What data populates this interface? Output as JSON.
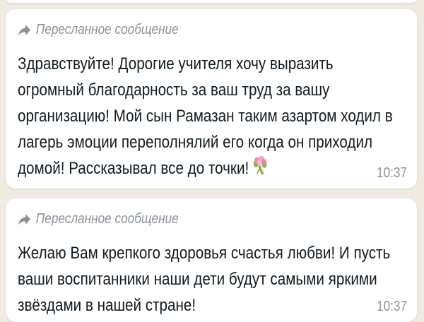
{
  "messages": [
    {
      "forwarded_label": "Пересланное сообщение",
      "text": "Здравствуйте! Дорогие учителя хочу выразить огромный благодарность за ваш труд за вашу организацию! Мой сын Рамазан таким азартом ходил в лагерь эмоции переполнялий его когда он приходил домой! Рассказывал все до точки!",
      "emoji": "bouquet",
      "time": "10:37"
    },
    {
      "forwarded_label": "Пересланное сообщение",
      "text": "Желаю Вам крепкого здоровья счастья любви! И пусть ваши воспитанники наши дети будут самыми яркими звёздами в нашей стране!",
      "time": "10:37"
    }
  ],
  "colors": {
    "background": "#efeae2",
    "bubble": "#ffffff",
    "meta_text": "#8a9199",
    "body_text": "#111b21"
  },
  "icons": {
    "forwarded": "forward-arrow-icon",
    "emoji": "bouquet-icon"
  }
}
